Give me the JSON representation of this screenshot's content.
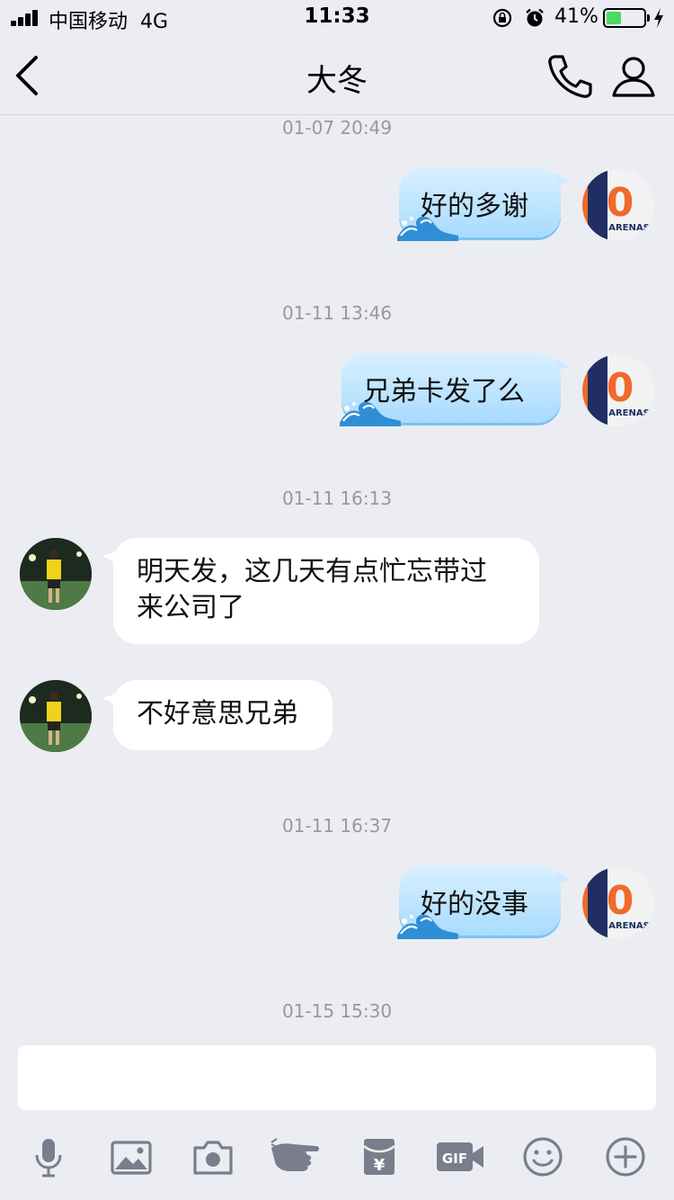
{
  "status_bar": {
    "carrier": "中国移动",
    "network": "4G",
    "time": "11:33",
    "battery_percent": "41%",
    "battery_level": 0.41,
    "battery_color": "#4cd964"
  },
  "nav": {
    "back_icon": "chevron-left-icon",
    "title": "大冬",
    "call_icon": "phone-icon",
    "profile_icon": "person-icon"
  },
  "messages": [
    {
      "type": "time",
      "text": "01-07 20:49"
    },
    {
      "type": "out",
      "text": "好的多谢",
      "avatar_text": "0",
      "avatar_caption": "ARENAS"
    },
    {
      "type": "time",
      "text": "01-11 13:46"
    },
    {
      "type": "out",
      "text": "兄弟卡发了么",
      "avatar_text": "0",
      "avatar_caption": "ARENAS"
    },
    {
      "type": "time",
      "text": "01-11 16:13"
    },
    {
      "type": "in",
      "line1": "明天发，这几天有点忙忘带过",
      "line2": "来公司了"
    },
    {
      "type": "in",
      "line1": "不好意思兄弟"
    },
    {
      "type": "time",
      "text": "01-11 16:37"
    },
    {
      "type": "out",
      "text": "好的没事",
      "avatar_text": "0",
      "avatar_caption": "ARENAS"
    },
    {
      "type": "time",
      "text": "01-15 15:30"
    }
  ],
  "input": {
    "value": "",
    "placeholder": ""
  },
  "toolbar": {
    "icons": [
      "microphone-icon",
      "image-icon",
      "camera-icon",
      "poke-hand-icon",
      "red-packet-icon",
      "gif-icon",
      "emoji-icon",
      "plus-icon"
    ],
    "gif_label": "GIF",
    "red_packet_symbol": "¥"
  },
  "colors": {
    "background": "#ebedf2",
    "bubble_out": "#a8dbff",
    "bubble_in": "#ffffff",
    "time_text": "#999999",
    "icon": "#7a7e8c"
  }
}
